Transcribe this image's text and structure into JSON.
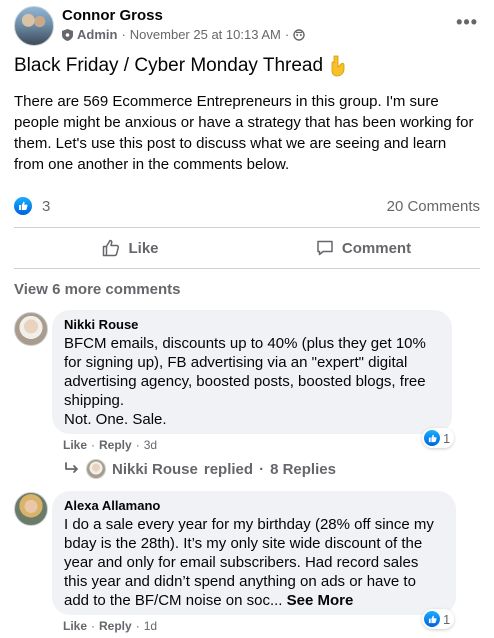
{
  "post": {
    "author": "Connor Gross",
    "role": "Admin",
    "timestamp": "November 25 at 10:13 AM",
    "separator": "·",
    "title": "Black Friday / Cyber Monday Thread",
    "body": "There are 569 Ecommerce Entrepreneurs in this group. I'm sure people might be anxious or have a strategy that has been working for them. Let's use this post to discuss what we are seeing and learn from one another in the comments below.",
    "reaction_count": "3",
    "comment_count": "20 Comments",
    "like_label": "Like",
    "comment_label": "Comment",
    "more_icon": "more-dots-icon"
  },
  "comments_section": {
    "view_more": "View 6 more comments",
    "comments": [
      {
        "name": "Nikki Rouse",
        "text_lines": [
          "BFCM emails, discounts up to 40% (plus they get 10%",
          "for signing up), FB advertising via an \"expert\" digital",
          "advertising agency, boosted posts, boosted blogs, free",
          "shipping.",
          "Not. One. Sale."
        ],
        "reaction_count": "1",
        "like": "Like",
        "reply": "Reply",
        "age": "3d",
        "dot": "·"
      },
      {
        "name": "Alexa Allamano",
        "text_lines": [
          "I do a sale every year for my birthday (28% off since my",
          "bday is the 28th). It’s my only site wide discount of the",
          "year and only for email subscribers. Had record sales",
          "this year and didn’t spend anything on ads or have to"
        ],
        "last_line": "add to the BF/CM noise on soc...",
        "see_more": "See More",
        "reaction_count": "1",
        "like": "Like",
        "reply": "Reply",
        "age": "1d",
        "dot": "·"
      }
    ],
    "replies_summary": {
      "name": "Nikki Rouse",
      "text": "replied",
      "count": "8 Replies",
      "dot": "·"
    }
  },
  "colors": {
    "text_primary": "#050505",
    "text_secondary": "#65676b",
    "bubble_bg": "#f0f2f5",
    "like_blue": "#1877f2",
    "divider": "#ced0d4"
  }
}
